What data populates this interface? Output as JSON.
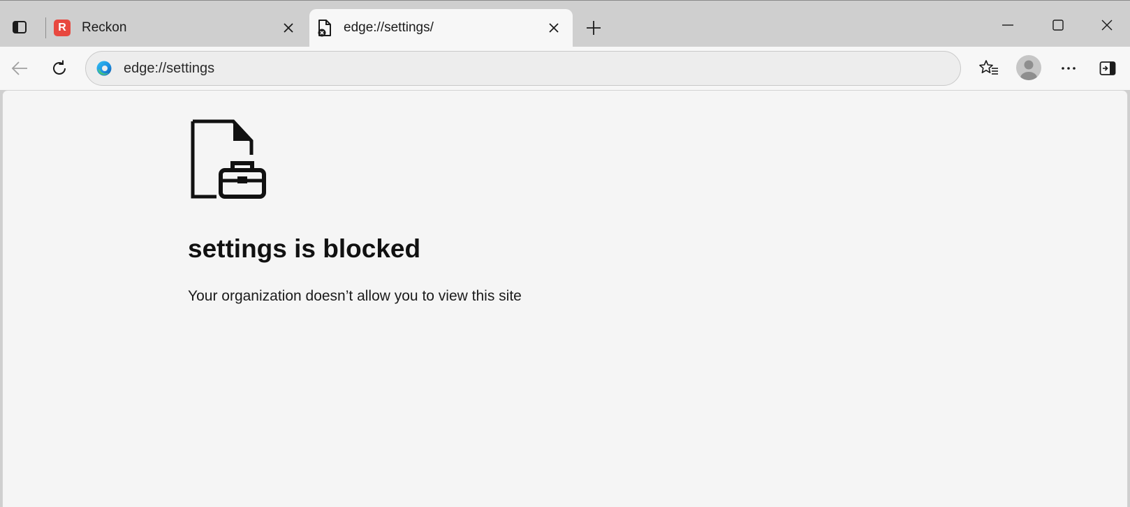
{
  "tabs": [
    {
      "title": "Reckon",
      "favicon_letter": "R",
      "active": false,
      "favicon_color": "#e8483f"
    },
    {
      "title": "edge://settings/",
      "active": true
    }
  ],
  "address_bar": {
    "value": "edge://settings"
  },
  "page": {
    "title": "settings is blocked",
    "description": "Your organization doesn’t allow you to view this site"
  },
  "icons": {
    "tab_actions": "tab-actions-icon",
    "close": "close-icon",
    "new_tab": "plus-icon",
    "minimize": "minimize-icon",
    "maximize": "maximize-icon",
    "window_close": "window-close-icon",
    "back": "back-arrow-icon",
    "refresh": "refresh-icon",
    "edge": "edge-logo-icon",
    "favorites": "favorites-icon",
    "more": "more-icon",
    "sidebar": "sidebar-toggle-icon",
    "blocked": "blocked-document-briefcase-icon"
  },
  "colors": {
    "tabstrip_bg": "#cfcfcf",
    "active_tab_bg": "#f7f7f7",
    "content_bg": "#f5f5f5"
  }
}
